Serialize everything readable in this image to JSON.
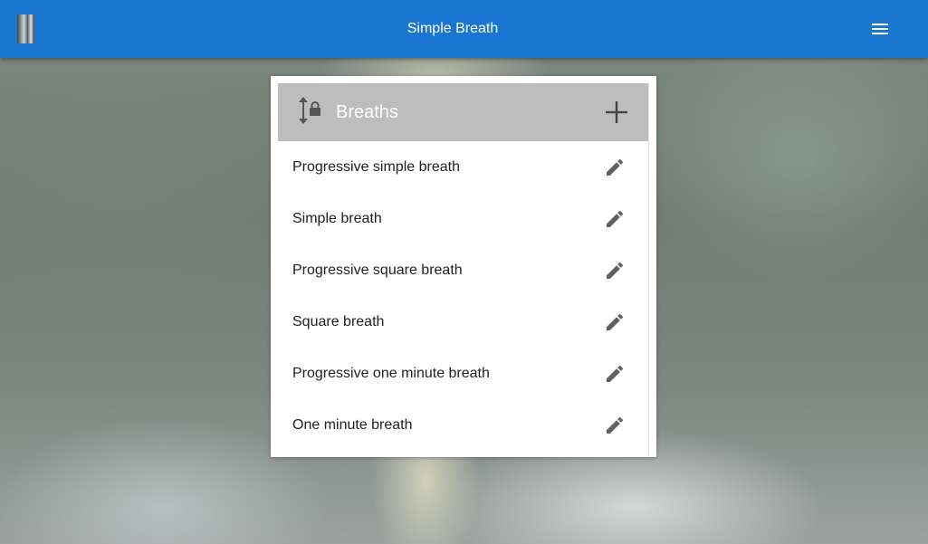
{
  "app": {
    "title": "Simple Breath",
    "brand_color": "#1976d2",
    "logo_icon": "tornado-logo",
    "menu_icon": "hamburger-menu-icon"
  },
  "breaths_card": {
    "title": "Breaths",
    "header_color": "#bdbdbd",
    "reorder_icon": "reorder-lock-icon",
    "add_icon": "plus-icon",
    "edit_icon": "pencil-icon",
    "items": [
      {
        "label": "Progressive simple breath"
      },
      {
        "label": "Simple breath"
      },
      {
        "label": "Progressive square breath"
      },
      {
        "label": "Square breath"
      },
      {
        "label": "Progressive one minute breath"
      },
      {
        "label": "One minute breath"
      }
    ]
  }
}
